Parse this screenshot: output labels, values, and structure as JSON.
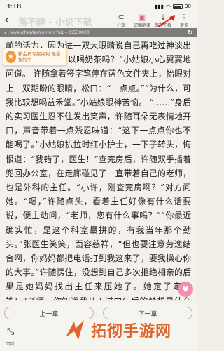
{
  "status": {
    "time": "3:18",
    "battery": "30"
  },
  "toolbar": {
    "back_icon": "back-arrow",
    "headline": "落不醉 - 小说下载",
    "items": [
      {
        "label": "分享",
        "icon": "share-icon",
        "glyph": "⊂"
      },
      {
        "label": "识图翻译",
        "icon": "translate-icon",
        "glyph": "▣"
      },
      {
        "label": "保存下载",
        "icon": "download-icon",
        "glyph": "⤓"
      },
      {
        "label": "更多",
        "icon": "more-icon",
        "glyph": "⋮"
      }
    ]
  },
  "url_bar": {
    "url": "novel/chapter/content?uid=25530000"
  },
  "ad_badge": {
    "text": "新会员专属福利 限量抢购中"
  },
  "chapter_text": "前的活力，因为进一双大眼睛说自己再吃过神淡出马 许医生，我可以喝奶茶吗？”小姑娘小心翼翼地问道。 许随拿着签字笔停在蓝色文件夹上，抬眼对上一双期盼的眼睛，松口：“一点点。”“为什么，可我比较想喝益禾堂。”小姑娘眼神苦恼。 “……”身后的实习医生忍不住发出笑声，许随耳朵无表情地开口，声音带着一点残忍味道：“这下一点点你也不能喝了。”小姑娘扒拉时红小护士，一下子转头，悔恨道：“我错了，医生！”查完房后，许随双手插着兜回办公室，在走廊碰见了一直带着自己的老师，也是外科的主任。“小许，刚查完房啊？”对方问她。“嗯，”许随点头，看着主任好像有什么话要说，便主动问，“老师，您有什么事吗？”“你最近确实忙，是这个科室最拼的，有我当年那个劲头。”张医生笑笑，面容慈祥，“但也要注意劳逸结合啊，你妈妈都把电话打到我这来了，要我操心你的大事。”许随愣住，没想到自己多次拒绝相亲的后果是她妈妈找出主任来压她了。她定了定心神：“老师，你知道我从入过中年后的梦想是什么吗？”“什么？”当媒婆，先拿我练手。”许随用手指向自己。“不去，这孩子嘴，”张主任关上，“好好，",
  "nav": {
    "prev": "上一章",
    "next": "下一章",
    "home_label": "回到"
  },
  "watermark": {
    "text": "拓彻手游网"
  },
  "colors": {
    "accent": "#e25a86",
    "brand": "#e0632d",
    "paper": "#f4f1ec"
  }
}
